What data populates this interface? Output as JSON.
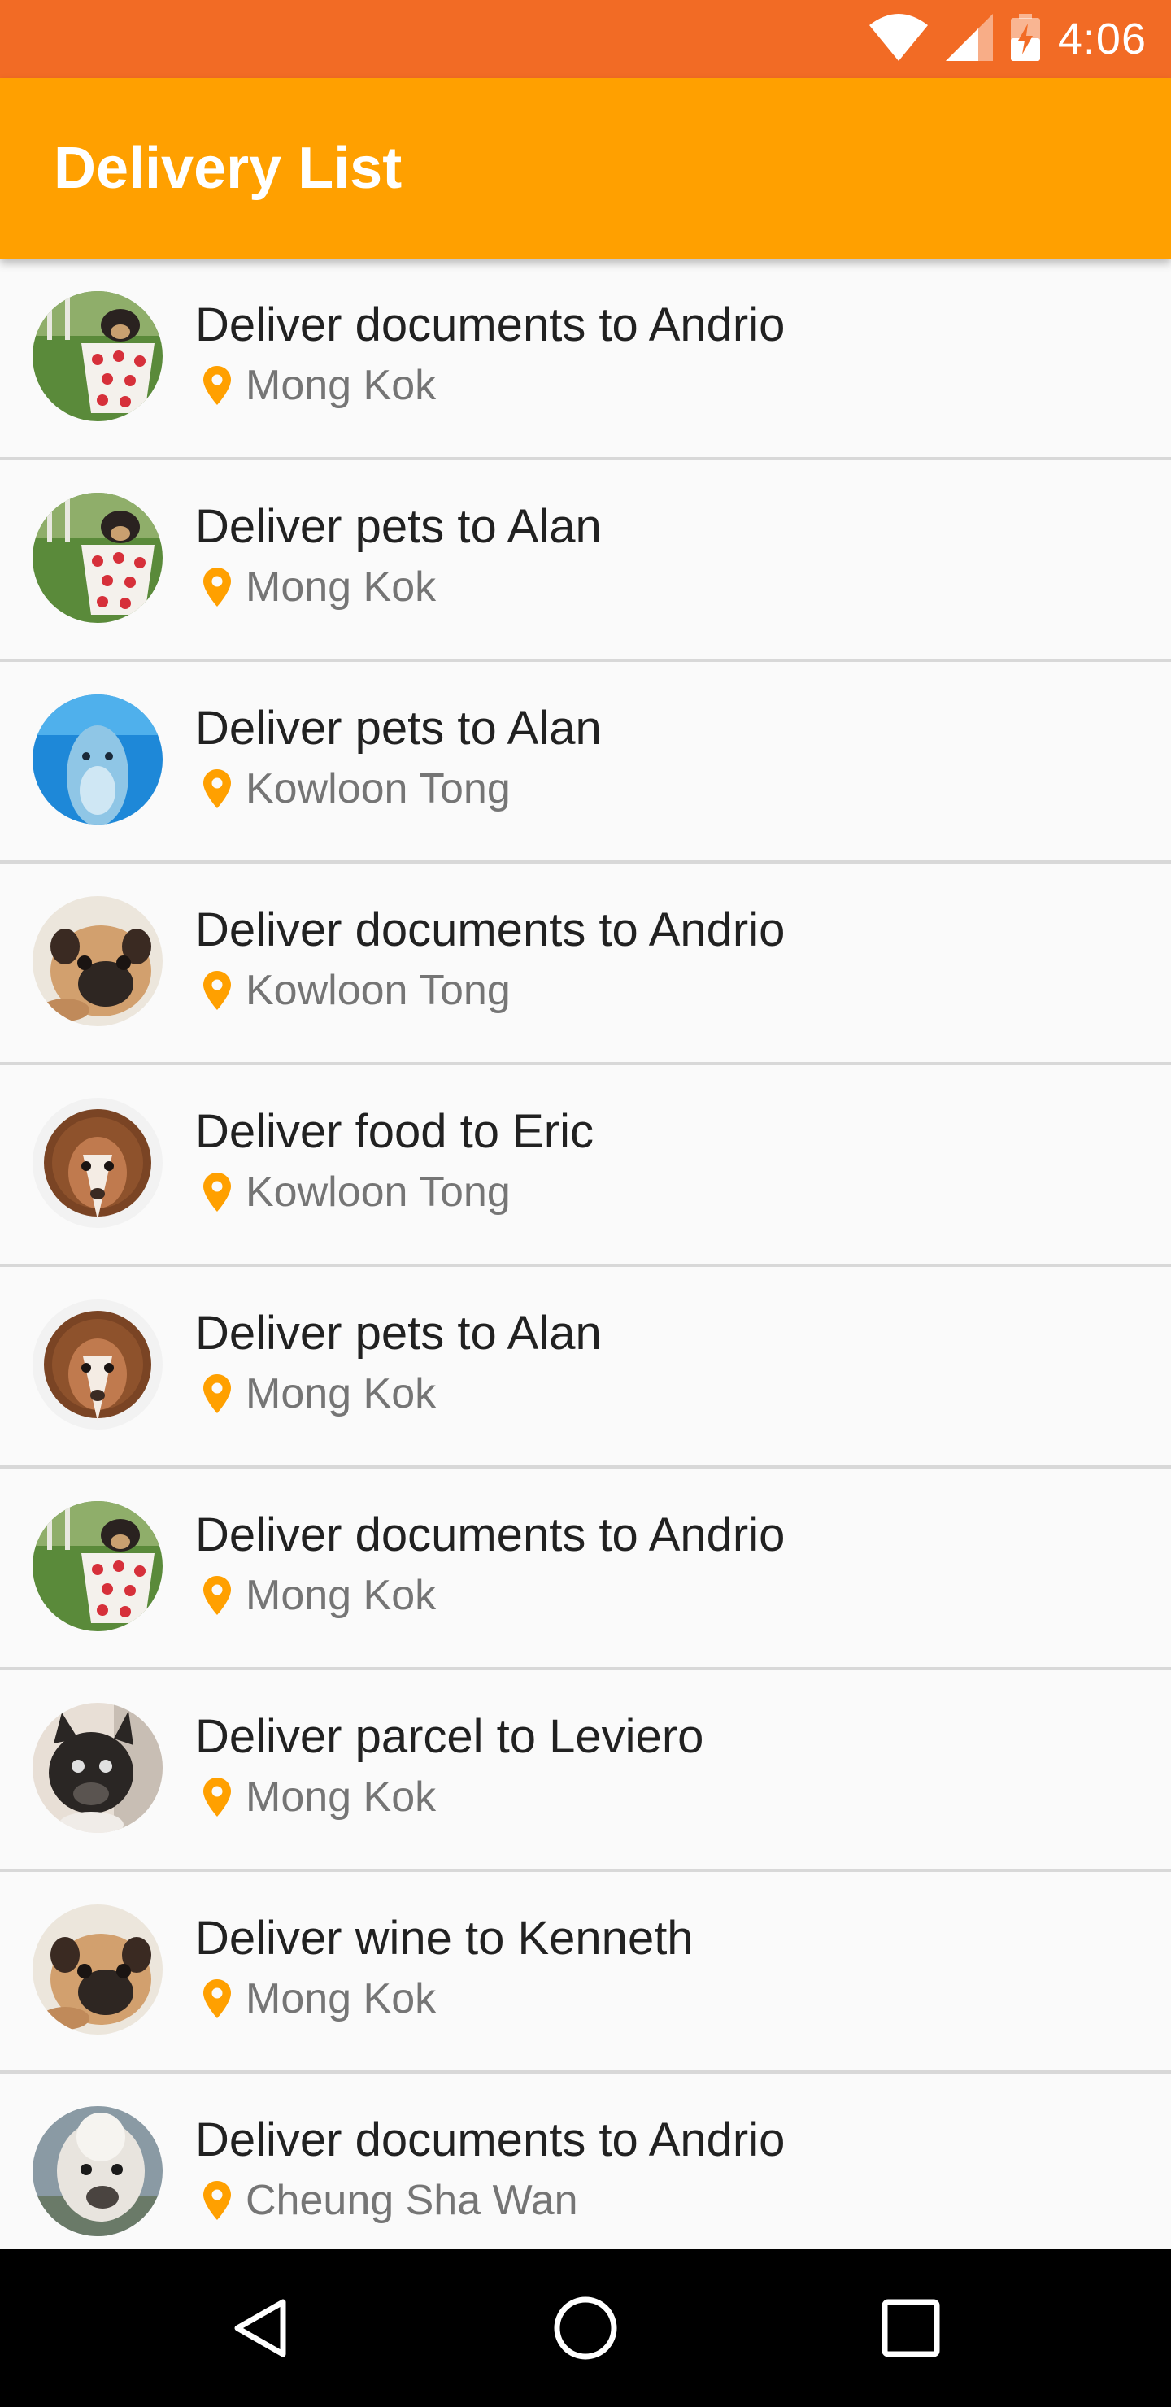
{
  "status_bar": {
    "time": "4:06",
    "icons": [
      "wifi-icon",
      "cellular-signal-icon",
      "battery-charging-icon"
    ],
    "background": "#f26b25"
  },
  "app_bar": {
    "title": "Delivery List",
    "background": "#ffa000"
  },
  "colors": {
    "accent": "#ffa000",
    "title_text": "#212121",
    "location_text": "#757575"
  },
  "deliveries": [
    {
      "title": "Deliver documents to Andrio",
      "location": "Mong Kok",
      "avatar": "puppy-in-cup"
    },
    {
      "title": "Deliver pets to Alan",
      "location": "Mong Kok",
      "avatar": "puppy-in-cup"
    },
    {
      "title": "Deliver pets to Alan",
      "location": "Kowloon Tong",
      "avatar": "dolphin"
    },
    {
      "title": "Deliver documents to Andrio",
      "location": "Kowloon Tong",
      "avatar": "pug"
    },
    {
      "title": "Deliver food to Eric",
      "location": "Kowloon Tong",
      "avatar": "dog-lion-costume"
    },
    {
      "title": "Deliver pets to Alan",
      "location": "Mong Kok",
      "avatar": "dog-lion-costume"
    },
    {
      "title": "Deliver documents to Andrio",
      "location": "Mong Kok",
      "avatar": "puppy-in-cup"
    },
    {
      "title": "Deliver parcel to Leviero",
      "location": "Mong Kok",
      "avatar": "french-bulldog"
    },
    {
      "title": "Deliver wine to Kenneth",
      "location": "Mong Kok",
      "avatar": "pug"
    },
    {
      "title": "Deliver documents to Andrio",
      "location": "Cheung Sha Wan",
      "avatar": "alpaca"
    }
  ],
  "nav_bar": {
    "buttons": [
      "back-icon",
      "home-icon",
      "recents-icon"
    ]
  }
}
